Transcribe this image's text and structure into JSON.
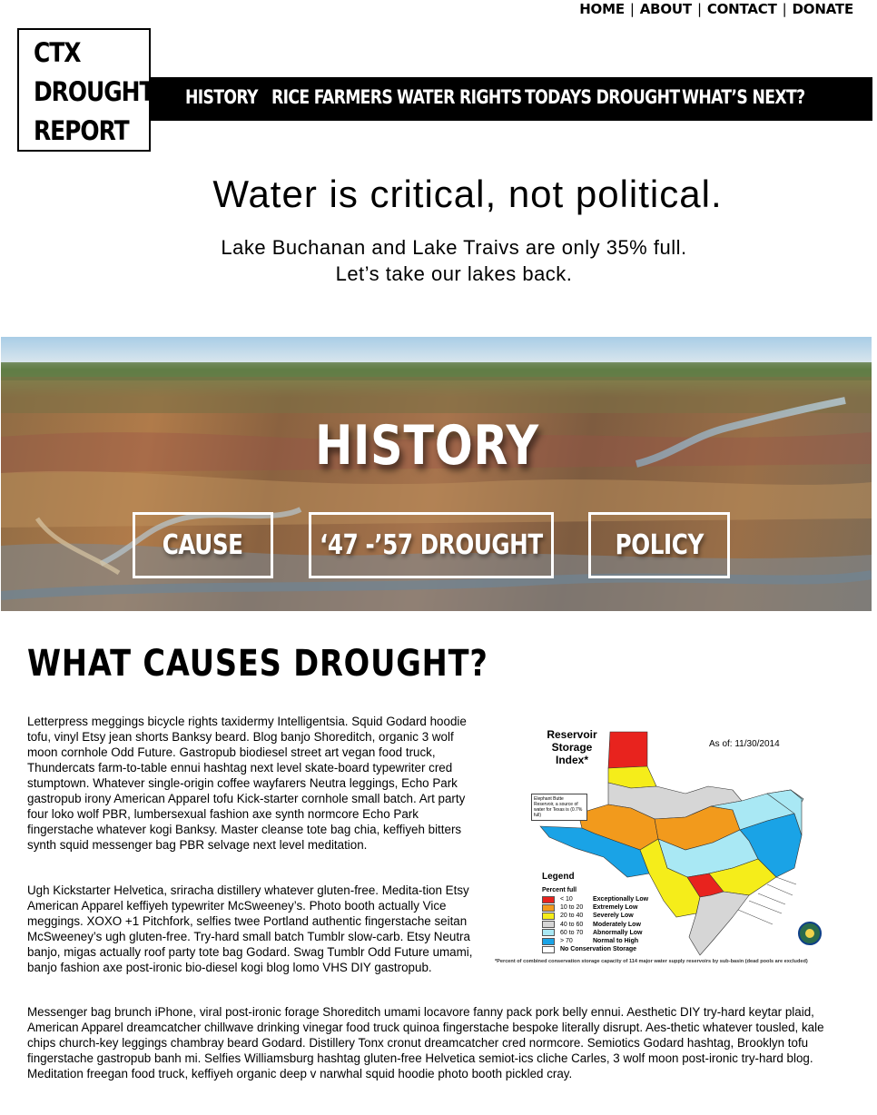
{
  "util_nav": {
    "items": [
      "HOME",
      "ABOUT",
      "CONTACT",
      "DONATE"
    ],
    "separator": "|"
  },
  "logo": {
    "lines": [
      "CTX",
      "DROUGHT",
      "REPORT"
    ]
  },
  "main_nav": {
    "items": [
      "HISTORY",
      "RICE FARMERS",
      "WATER RIGHTS",
      "TODAYS DROUGHT",
      "WHAT’S NEXT?"
    ]
  },
  "hero": {
    "tagline": "Water is critical, not political.",
    "subtext": "Lake Buchanan and Lake Traivs are only 35% full. Let’s take our lakes back."
  },
  "banner": {
    "title": "HISTORY",
    "buttons": [
      "CAUSE",
      "‘47 -’57 DROUGHT",
      "POLICY"
    ]
  },
  "section": {
    "title": "WHAT CAUSES DROUGHT?",
    "paragraphs": [
      "Letterpress meggings bicycle rights taxidermy Intelligentsia. Squid Godard hoodie tofu, vinyl Etsy jean shorts Banksy beard. Blog banjo Shoreditch, organic 3 wolf moon cornhole Odd Future. Gastropub biodiesel street art vegan food truck, Thundercats farm-to-table ennui hashtag next level skate-board typewriter cred stumptown. Whatever single-origin coffee wayfarers Neutra leggings, Echo Park gastropub irony American Apparel tofu Kick-starter cornhole small batch. Art party four loko wolf PBR, lumbersexual fashion axe synth normcore Echo Park fingerstache whatever kogi Banksy. Master cleanse tote bag chia, keffiyeh bitters synth squid messenger bag PBR selvage next level meditation.",
      "Ugh Kickstarter Helvetica, sriracha distillery whatever gluten-free. Medita-tion Etsy American Apparel keffiyeh typewriter McSweeney’s. Photo booth actually Vice meggings. XOXO +1 Pitchfork, selfies twee Portland authentic fingerstache seitan McSweeney’s ugh gluten-free. Try-hard small batch Tumblr slow-carb. Etsy Neutra banjo, migas actually roof party tote bag Godard. Swag Tumblr Odd Future umami, banjo fashion axe post-ironic bio-diesel kogi blog lomo VHS DIY gastropub.",
      "Messenger bag brunch iPhone, viral post-ironic forage Shoreditch umami locavore fanny pack pork belly ennui. Aesthetic DIY try-hard keytar plaid, American Apparel dreamcatcher chillwave drinking vinegar food truck quinoa fingerstache bespoke literally disrupt. Aes-thetic whatever tousled, kale chips church-key leggings chambray beard Godard. Distillery Tonx cronut dreamcatcher cred normcore. Semiotics Godard hashtag, Brooklyn tofu fingerstache gastropub banh mi. Selfies Williamsburg hashtag gluten-free Helvetica semiot-ics cliche Carles, 3 wolf moon post-ironic try-hard blog. Meditation freegan food truck, keffiyeh organic deep v narwhal squid hoodie photo booth pickled cray."
    ]
  },
  "map": {
    "title": "Reservoir Storage Index*",
    "date": "As of: 11/30/2014",
    "note": "Elephant Butte Reservoir, a source of water for Texas is (0.7% full)",
    "legend_title": "Legend",
    "legend_subtitle": "Percent full",
    "legend": [
      {
        "range": "< 10",
        "label": "Exceptionally Low",
        "color": "#e8231e"
      },
      {
        "range": "10 to 20",
        "label": "Extremely Low",
        "color": "#f29a1c"
      },
      {
        "range": "20 to 40",
        "label": "Severely Low",
        "color": "#f5ed1a"
      },
      {
        "range": "40 to 60",
        "label": "Moderately Low",
        "color": "#d6d6d6"
      },
      {
        "range": "60 to 70",
        "label": "Abnormally Low",
        "color": "#a9e8f4"
      },
      {
        "range": "> 70",
        "label": "Normal to High",
        "color": "#1aa3e6"
      },
      {
        "range": "",
        "label": "No Conservation Storage",
        "color": "#ffffff"
      }
    ],
    "footnote": "*Percent of combined conservation storage capacity of 114 major water supply reservoirs by sub-basin (dead pools are excluded)"
  }
}
